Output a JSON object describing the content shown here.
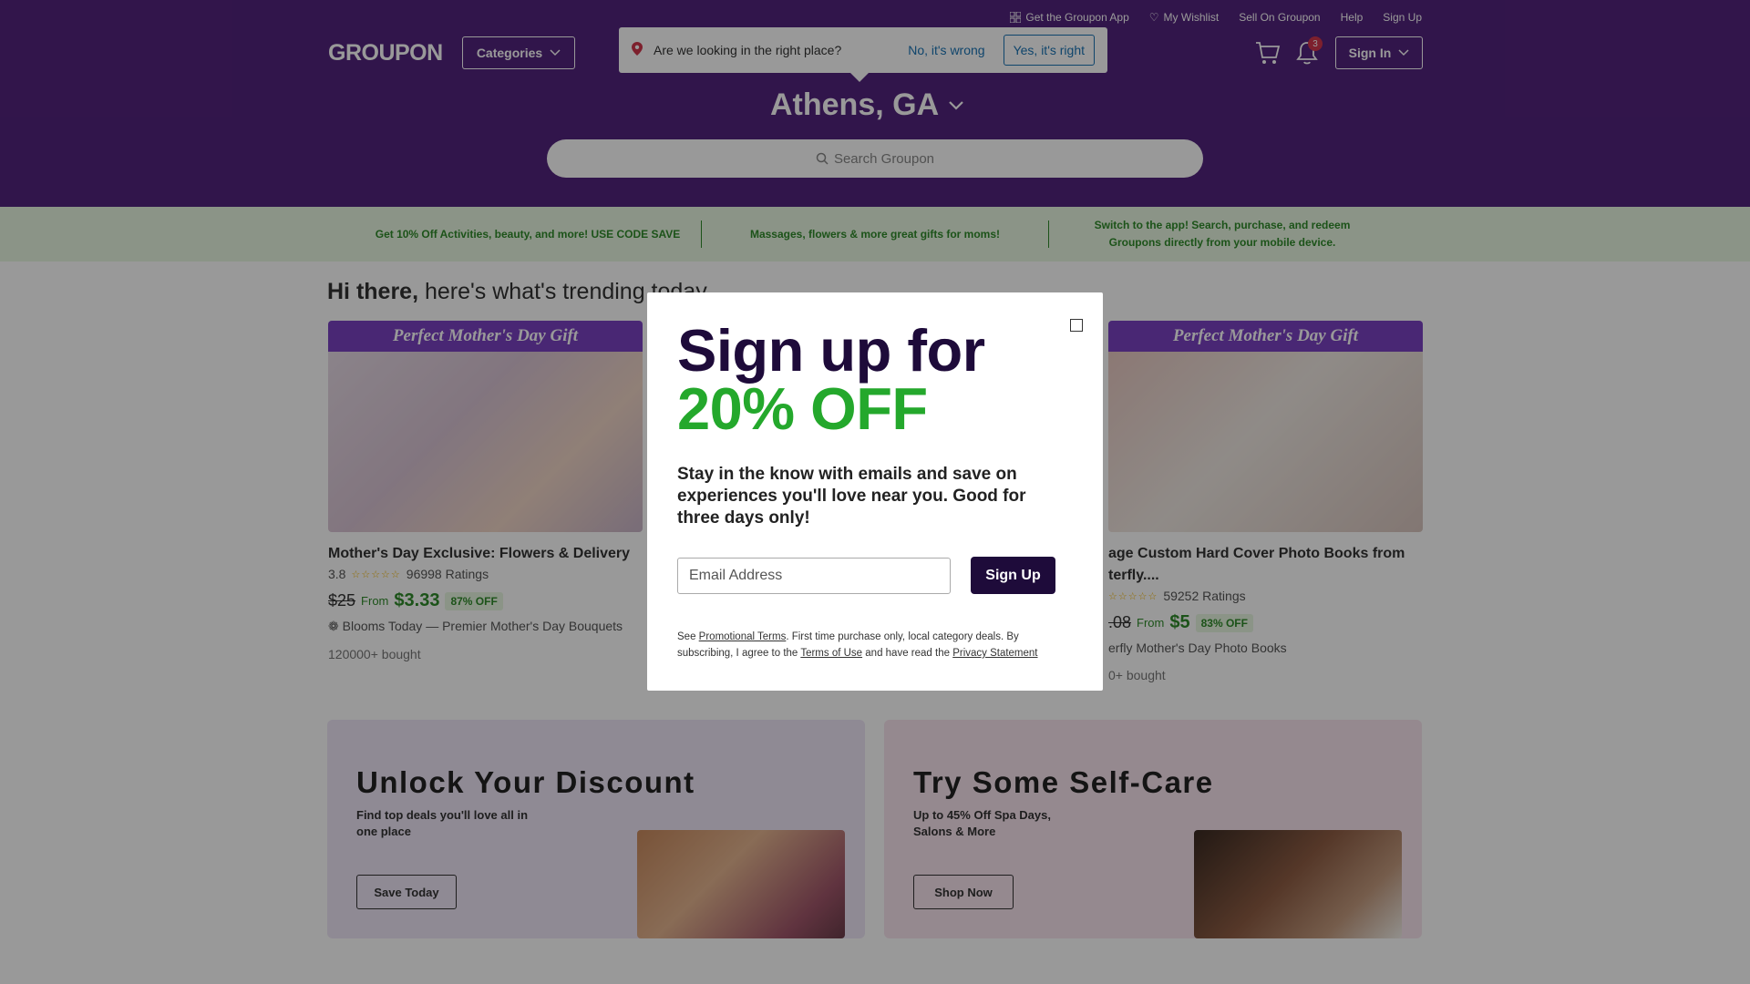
{
  "header": {
    "top_links": {
      "app": "Get the Groupon App",
      "wishlist": "My Wishlist",
      "sell": "Sell On Groupon",
      "help": "Help",
      "signup": "Sign Up"
    },
    "logo": "GROUPON",
    "categories": "Categories",
    "notification_count": "3",
    "signin": "Sign In",
    "location_prompt": {
      "question": "Are we looking in the right place?",
      "no": "No, it's wrong",
      "yes": "Yes, it's right"
    },
    "city": "Athens, GA",
    "search_placeholder": "Search Groupon"
  },
  "promo_bar": [
    "Get 10% Off Activities, beauty, and more! USE CODE SAVE",
    "Massages, flowers & more great gifts for moms!",
    "Switch to the app! Search, purchase, and redeem Groupons directly from your mobile device."
  ],
  "main": {
    "greeting_bold": "Hi there,",
    "greeting_rest": "here's what's trending today",
    "cards": [
      {
        "banner": "Perfect Mother's Day Gift",
        "title": "Mother's Day Exclusive: Flowers & Delivery",
        "rating": "3.8",
        "ratings_count": "96998 Ratings",
        "orig_price": "$25",
        "from": "From",
        "price": "$3.33",
        "off": "87% OFF",
        "merchant": "Blooms Today — Premier Mother's Day Bouquets",
        "bought": "120000+ bought"
      },
      {
        "banner": "Perfect Mother's Day Gift",
        "title": "age Custom Hard Cover Photo Books from terfly....",
        "ratings_count": "59252 Ratings",
        "orig_price": ".08",
        "from": "From",
        "price": "$5",
        "off": "83% OFF",
        "merchant": "erfly Mother's Day Photo Books",
        "bought": "0+ bought"
      }
    ],
    "promos": [
      {
        "title": "Unlock Your Discount",
        "text": "Find top deals you'll love all in one place",
        "button": "Save Today"
      },
      {
        "title": "Try Some Self-Care",
        "text": "Up to 45% Off Spa Days, Salons & More",
        "button": "Shop Now"
      }
    ]
  },
  "modal": {
    "headline": "Sign up for",
    "headline_green": "20% OFF",
    "description": "Stay in the know with emails and save on experiences you'll love near you. Good for three days only!",
    "email_placeholder": "Email Address",
    "signup_button": "Sign Up",
    "fine_prefix": "See ",
    "promo_terms": "Promotional Terms",
    "fine_middle": ". First time purchase only, local category deals. By subscribing, I agree to the ",
    "terms_of_use": "Terms of Use",
    "fine_and": " and have read the ",
    "privacy": "Privacy Statement"
  },
  "colors": {
    "header_bg": "#53237d",
    "accent_green": "#24a82c",
    "modal_dark": "#1e0b3a"
  }
}
